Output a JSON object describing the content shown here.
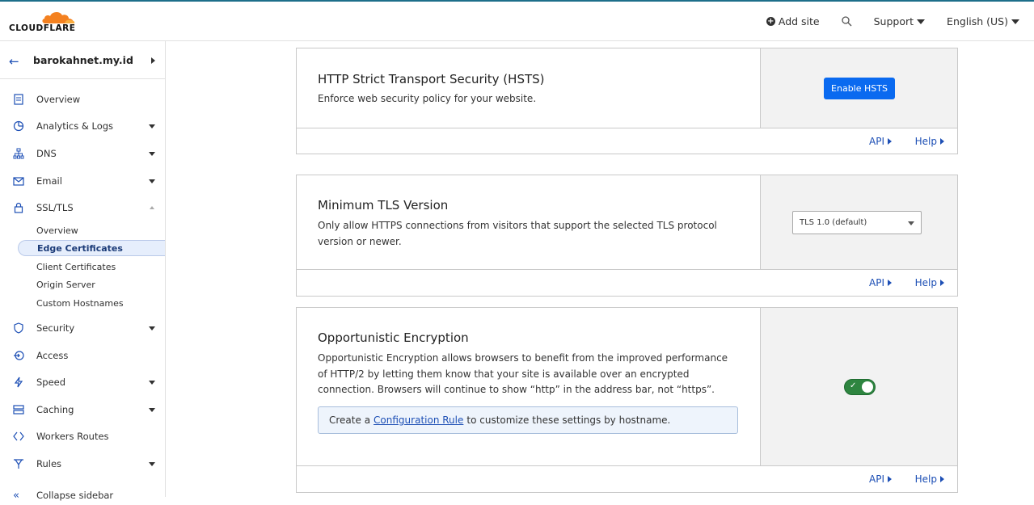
{
  "header": {
    "logo_text": "CLOUDFLARE",
    "add_site": "Add site",
    "support": "Support",
    "language": "English (US)"
  },
  "sidebar": {
    "zone_name": "barokahnet.my.id",
    "items": [
      {
        "label": "Overview"
      },
      {
        "label": "Analytics & Logs"
      },
      {
        "label": "DNS"
      },
      {
        "label": "Email"
      },
      {
        "label": "SSL/TLS"
      },
      {
        "label": "Security"
      },
      {
        "label": "Access"
      },
      {
        "label": "Speed"
      },
      {
        "label": "Caching"
      },
      {
        "label": "Workers Routes"
      },
      {
        "label": "Rules"
      }
    ],
    "ssl_sub": [
      {
        "label": "Overview"
      },
      {
        "label": "Edge Certificates"
      },
      {
        "label": "Client Certificates"
      },
      {
        "label": "Origin Server"
      },
      {
        "label": "Custom Hostnames"
      }
    ],
    "collapse": "Collapse sidebar"
  },
  "cards": {
    "hsts": {
      "title": "HTTP Strict Transport Security (HSTS)",
      "description": "Enforce web security policy for your website.",
      "button": "Enable HSTS",
      "api": "API",
      "help": "Help"
    },
    "tls": {
      "title": "Minimum TLS Version",
      "description": "Only allow HTTPS connections from visitors that support the selected TLS protocol version or newer.",
      "selected": "TLS 1.0 (default)",
      "api": "API",
      "help": "Help"
    },
    "oe": {
      "title": "Opportunistic Encryption",
      "description": "Opportunistic Encryption allows browsers to benefit from the improved performance of HTTP/2 by letting them know that your site is available over an encrypted connection. Browsers will continue to show “http” in the address bar, not “https”.",
      "info_prefix": "Create a",
      "info_link": "Configuration Rule",
      "info_suffix": "to customize these settings by hostname.",
      "toggle_on": true,
      "api": "API",
      "help": "Help"
    }
  },
  "colors": {
    "accent": "#0a6af0",
    "link": "#1d4fb5",
    "toggle_on": "#2e8540"
  }
}
